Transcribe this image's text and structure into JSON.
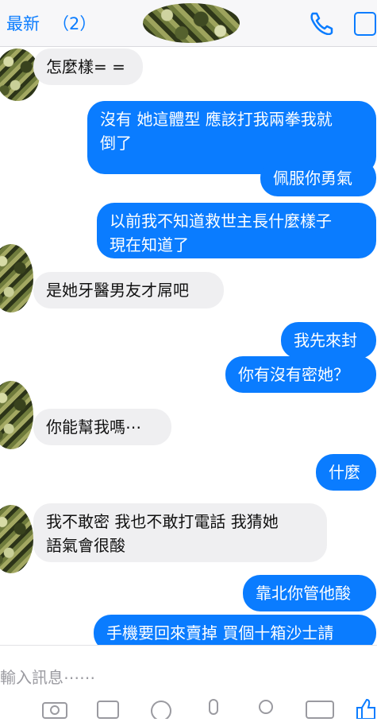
{
  "header": {
    "back_label": "最新",
    "unread_count": "（2）"
  },
  "messages": [
    {
      "side": "in",
      "text": "怎麼樣= ="
    },
    {
      "side": "out",
      "text": "沒有 她這體型 應該打我兩拳我就\n倒了"
    },
    {
      "side": "out",
      "text": "佩服你勇氣"
    },
    {
      "side": "out",
      "text": "以前我不知道救世主長什麼樣子\n現在知道了"
    },
    {
      "side": "in",
      "text": "是她牙醫男友才屌吧"
    },
    {
      "side": "out",
      "text": "我先來封"
    },
    {
      "side": "out",
      "text": "你有沒有密她？"
    },
    {
      "side": "in",
      "text": "你能幫我嗎⋯"
    },
    {
      "side": "out",
      "text": "什麼"
    },
    {
      "side": "in",
      "text": "我不敢密 我也不敢打電話 我猜她\n語氣會很酸"
    },
    {
      "side": "out",
      "text": "靠北你管他酸"
    },
    {
      "side": "out",
      "text": "手機要回來賣掉 買個十箱沙士請"
    }
  ],
  "composer": {
    "placeholder": "輸入訊息⋯⋯"
  },
  "colors": {
    "accent": "#0a7cff",
    "incoming_bubble": "#efeff1"
  }
}
